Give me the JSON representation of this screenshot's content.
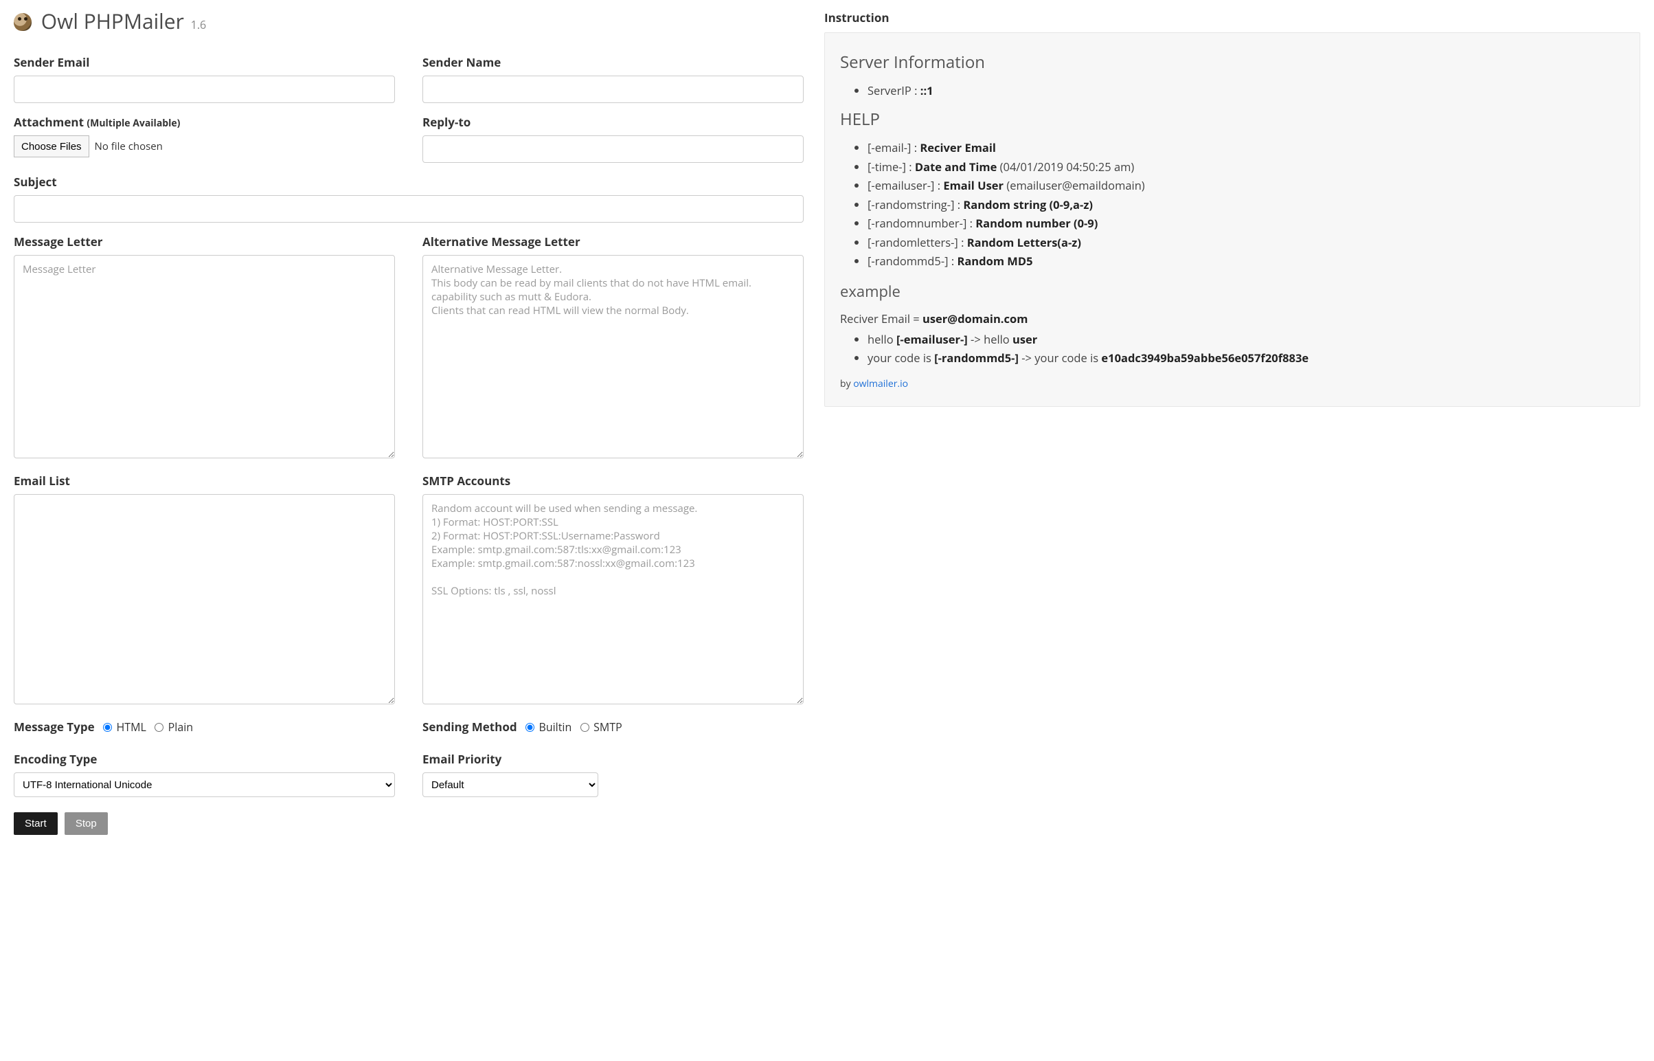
{
  "app": {
    "name": "Owl PHPMailer",
    "version": "1.6"
  },
  "form": {
    "sender_email": {
      "label": "Sender Email",
      "value": ""
    },
    "sender_name": {
      "label": "Sender Name",
      "value": ""
    },
    "attachment": {
      "label": "Attachment",
      "sub": "(Multiple Available)",
      "button": "Choose Files",
      "status": "No file chosen"
    },
    "reply_to": {
      "label": "Reply-to",
      "value": ""
    },
    "subject": {
      "label": "Subject",
      "value": ""
    },
    "message": {
      "label": "Message Letter",
      "placeholder": "Message Letter",
      "value": ""
    },
    "altmessage": {
      "label": "Alternative Message Letter",
      "placeholder": "Alternative Message Letter.\nThis body can be read by mail clients that do not have HTML email.\ncapability such as mutt & Eudora.\nClients that can read HTML will view the normal Body.",
      "value": ""
    },
    "email_list": {
      "label": "Email List",
      "value": ""
    },
    "smtp": {
      "label": "SMTP Accounts",
      "placeholder": "Random account will be used when sending a message.\n1) Format: HOST:PORT:SSL\n2) Format: HOST:PORT:SSL:Username:Password\nExample: smtp.gmail.com:587:tls:xx@gmail.com:123\nExample: smtp.gmail.com:587:nossl:xx@gmail.com:123\n\nSSL Options: tls , ssl, nossl",
      "value": ""
    },
    "msg_type": {
      "label": "Message Type",
      "opts": [
        "HTML",
        "Plain"
      ],
      "selected": "HTML"
    },
    "send_method": {
      "label": "Sending Method",
      "opts": [
        "Builtin",
        "SMTP"
      ],
      "selected": "Builtin"
    },
    "encoding": {
      "label": "Encoding Type",
      "selected": "UTF-8 International Unicode"
    },
    "priority": {
      "label": "Email Priority",
      "selected": "Default"
    },
    "actions": {
      "start": "Start",
      "stop": "Stop"
    }
  },
  "instruction": {
    "title": "Instruction",
    "server_info_heading": "Server Information",
    "server_ip_label": "ServerIP : ",
    "server_ip_value": "::1",
    "help_heading": "HELP",
    "help": [
      {
        "token": "[-email-] : ",
        "bold": "Reciver Email",
        "after": ""
      },
      {
        "token": "[-time-] : ",
        "bold": "Date and Time",
        "after": " (04/01/2019 04:50:25 am)"
      },
      {
        "token": "[-emailuser-] : ",
        "bold": "Email User",
        "after": " (emailuser@emaildomain)"
      },
      {
        "token": "[-randomstring-] : ",
        "bold": "Random string (0-9,a-z)",
        "after": ""
      },
      {
        "token": "[-randomnumber-] : ",
        "bold": "Random number (0-9)",
        "after": ""
      },
      {
        "token": "[-randomletters-] : ",
        "bold": "Random Letters(a-z)",
        "after": ""
      },
      {
        "token": "[-randommd5-] : ",
        "bold": "Random MD5",
        "after": ""
      }
    ],
    "example_heading": "example",
    "example_line_pre": "Reciver Email = ",
    "example_line_bold": "user@domain.com",
    "examples": [
      {
        "pre": "hello ",
        "b1": "[-emailuser-]",
        "mid": " -> hello ",
        "b2": "user",
        "post": ""
      },
      {
        "pre": "your code is ",
        "b1": "[-randommd5-]",
        "mid": " -> your code is ",
        "b2": "e10adc3949ba59abbe56e057f20f883e",
        "post": ""
      }
    ],
    "by_pre": "by ",
    "by_link": "owlmailer.io"
  }
}
